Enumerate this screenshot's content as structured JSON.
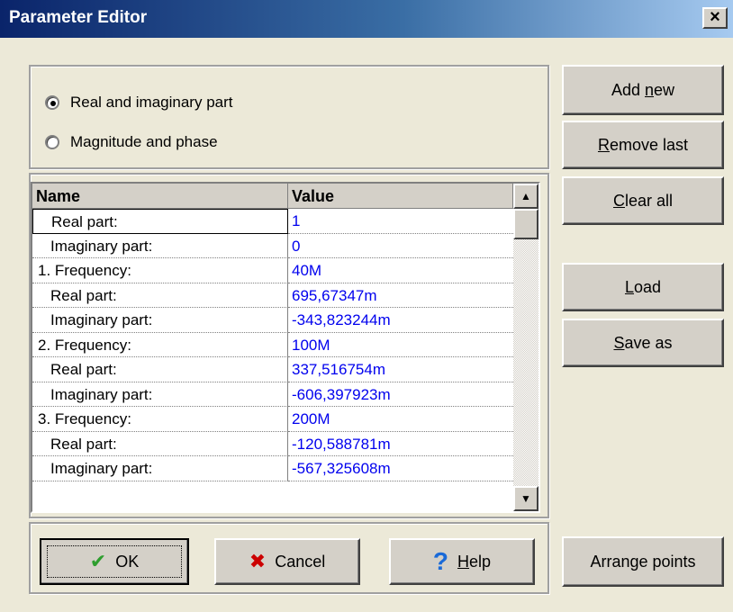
{
  "window": {
    "title": "Parameter Editor",
    "close_glyph": "×"
  },
  "mode": {
    "options": [
      {
        "label": "Real and imaginary part",
        "checked": true
      },
      {
        "label": "Magnitude and phase",
        "checked": false
      }
    ]
  },
  "side_buttons": {
    "add_new": {
      "pre": "Add ",
      "key": "n",
      "post": "ew"
    },
    "remove_last": {
      "pre": "",
      "key": "R",
      "post": "emove last"
    },
    "clear_all": {
      "pre": "",
      "key": "C",
      "post": "lear all"
    },
    "load": {
      "pre": "",
      "key": "L",
      "post": "oad"
    },
    "save_as": {
      "pre": "",
      "key": "S",
      "post": "ave as"
    },
    "arrange_points": "Arrange points"
  },
  "grid": {
    "columns": [
      "Name",
      "Value"
    ],
    "rows": [
      {
        "name": "Real part:",
        "value": "1",
        "indent": true
      },
      {
        "name": "Imaginary part:",
        "value": "0",
        "indent": true
      },
      {
        "name": "1.  Frequency:",
        "value": "40M",
        "indent": false
      },
      {
        "name": "Real part:",
        "value": "695,67347m",
        "indent": true
      },
      {
        "name": "Imaginary part:",
        "value": "-343,823244m",
        "indent": true
      },
      {
        "name": "2.  Frequency:",
        "value": "100M",
        "indent": false
      },
      {
        "name": "Real part:",
        "value": "337,516754m",
        "indent": true
      },
      {
        "name": "Imaginary part:",
        "value": "-606,397923m",
        "indent": true
      },
      {
        "name": "3.  Frequency:",
        "value": "200M",
        "indent": false
      },
      {
        "name": "Real part:",
        "value": "-120,588781m",
        "indent": true
      },
      {
        "name": "Imaginary part:",
        "value": "-567,325608m",
        "indent": true
      }
    ]
  },
  "bottom_buttons": {
    "ok": "OK",
    "cancel": "Cancel",
    "help": {
      "pre": "",
      "key": "H",
      "post": "elp"
    }
  },
  "colors": {
    "value_text": "#0000ee",
    "ok_icon": "#2e9e2e",
    "cancel_icon": "#cc0000",
    "help_icon": "#1a6ad8"
  },
  "icons": {
    "ok": "check-icon",
    "cancel": "x-icon",
    "help": "question-icon"
  }
}
